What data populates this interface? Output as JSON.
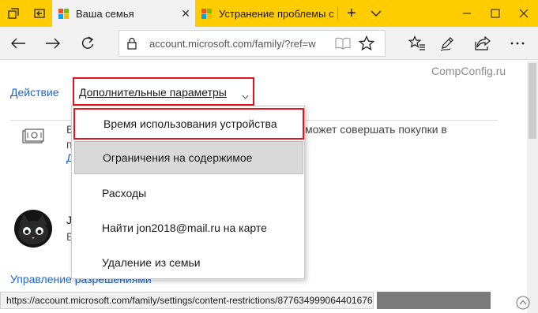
{
  "tabs": [
    {
      "title": "Ваша семья",
      "active": true,
      "close": "✕"
    },
    {
      "title": "Устранение проблемы с",
      "active": false
    }
  ],
  "tab_actions": {
    "new_tab": "+"
  },
  "navbar": {
    "address": "account.microsoft.com/family/?ref=w"
  },
  "watermark": "CompConfig.ru",
  "page": {
    "action_link": "Действие",
    "more_params": "Дополнительные параметры",
    "purchase_fragment_left": "В",
    "purchase_fragment_right": "может совершать покупки в",
    "row_fragment_a": "п",
    "row_fragment_b": "Д",
    "member_fragment_a": "J",
    "member_fragment_b": "E",
    "permissions_link": "Управление разрешениями"
  },
  "menu": {
    "items": [
      "Время использования устройства",
      "Ограничения на содержимое",
      "Расходы",
      "Найти jon2018@mail.ru на карте",
      "Удаление из семьи"
    ]
  },
  "status_url": "https://account.microsoft.com/family/settings/content-restrictions/877634999064401676",
  "colors": {
    "tabstrip": "#ffcc00",
    "link": "#1e66c8",
    "highlight": "#e0141e",
    "ms_logo": [
      "#f25022",
      "#7fba00",
      "#00a4ef",
      "#ffb900"
    ]
  }
}
